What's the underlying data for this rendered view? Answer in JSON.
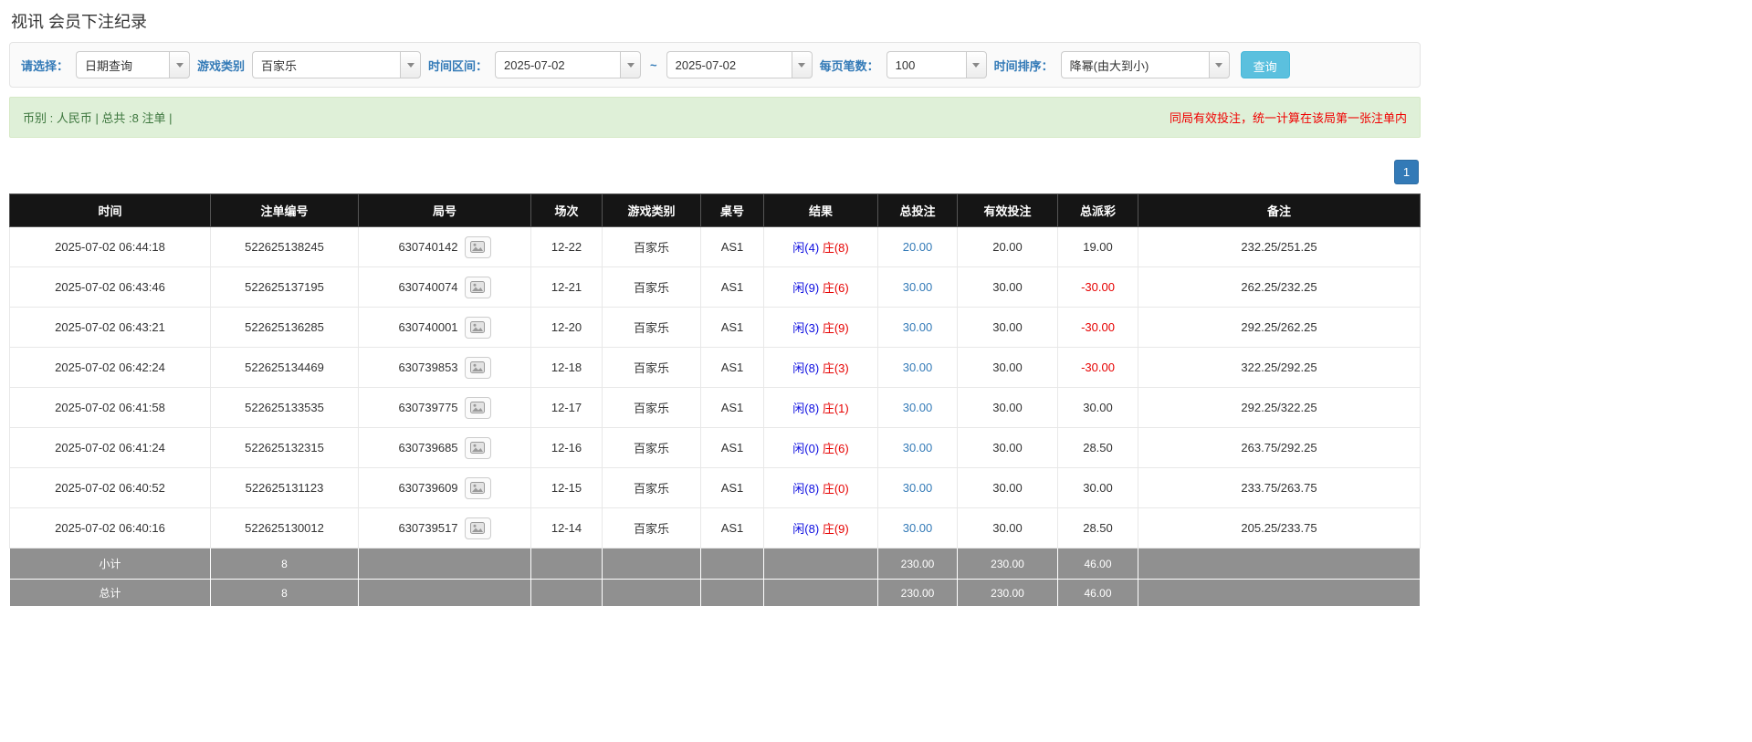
{
  "page": {
    "title": "视讯 会员下注纪录"
  },
  "filters": {
    "select_label": "请选择：",
    "select_value": "日期查询",
    "game_label": "游戏类别",
    "game_value": "百家乐",
    "range_label": "时间区间：",
    "range_from": "2025-07-02",
    "range_sep": "~",
    "range_to": "2025-07-02",
    "page_size_label": "每页笔数：",
    "page_size_value": "100",
    "sort_label": "时间排序：",
    "sort_value": "降幂(由大到小)",
    "search_button": "查询"
  },
  "summary": {
    "left": "币别 : 人民币 | 总共 :8 注单 |",
    "right": "同局有效投注，统一计算在该局第一张注单内"
  },
  "pagination": {
    "page": "1"
  },
  "table": {
    "headers": [
      "时间",
      "注单编号",
      "局号",
      "场次",
      "游戏类别",
      "桌号",
      "结果",
      "总投注",
      "有效投注",
      "总派彩",
      "备注"
    ],
    "rows": [
      {
        "time": "2025-07-02 06:44:18",
        "bet_id": "522625138245",
        "round": "630740142",
        "session": "12-22",
        "game": "百家乐",
        "table_no": "AS1",
        "result_player": "闲(4)",
        "result_banker": "庄(8)",
        "total_bet": "20.00",
        "valid_bet": "20.00",
        "payout": "19.00",
        "remark": "232.25/251.25"
      },
      {
        "time": "2025-07-02 06:43:46",
        "bet_id": "522625137195",
        "round": "630740074",
        "session": "12-21",
        "game": "百家乐",
        "table_no": "AS1",
        "result_player": "闲(9)",
        "result_banker": "庄(6)",
        "total_bet": "30.00",
        "valid_bet": "30.00",
        "payout": "-30.00",
        "remark": "262.25/232.25"
      },
      {
        "time": "2025-07-02 06:43:21",
        "bet_id": "522625136285",
        "round": "630740001",
        "session": "12-20",
        "game": "百家乐",
        "table_no": "AS1",
        "result_player": "闲(3)",
        "result_banker": "庄(9)",
        "total_bet": "30.00",
        "valid_bet": "30.00",
        "payout": "-30.00",
        "remark": "292.25/262.25"
      },
      {
        "time": "2025-07-02 06:42:24",
        "bet_id": "522625134469",
        "round": "630739853",
        "session": "12-18",
        "game": "百家乐",
        "table_no": "AS1",
        "result_player": "闲(8)",
        "result_banker": "庄(3)",
        "total_bet": "30.00",
        "valid_bet": "30.00",
        "payout": "-30.00",
        "remark": "322.25/292.25"
      },
      {
        "time": "2025-07-02 06:41:58",
        "bet_id": "522625133535",
        "round": "630739775",
        "session": "12-17",
        "game": "百家乐",
        "table_no": "AS1",
        "result_player": "闲(8)",
        "result_banker": "庄(1)",
        "total_bet": "30.00",
        "valid_bet": "30.00",
        "payout": "30.00",
        "remark": "292.25/322.25"
      },
      {
        "time": "2025-07-02 06:41:24",
        "bet_id": "522625132315",
        "round": "630739685",
        "session": "12-16",
        "game": "百家乐",
        "table_no": "AS1",
        "result_player": "闲(0)",
        "result_banker": "庄(6)",
        "total_bet": "30.00",
        "valid_bet": "30.00",
        "payout": "28.50",
        "remark": "263.75/292.25"
      },
      {
        "time": "2025-07-02 06:40:52",
        "bet_id": "522625131123",
        "round": "630739609",
        "session": "12-15",
        "game": "百家乐",
        "table_no": "AS1",
        "result_player": "闲(8)",
        "result_banker": "庄(0)",
        "total_bet": "30.00",
        "valid_bet": "30.00",
        "payout": "30.00",
        "remark": "233.75/263.75"
      },
      {
        "time": "2025-07-02 06:40:16",
        "bet_id": "522625130012",
        "round": "630739517",
        "session": "12-14",
        "game": "百家乐",
        "table_no": "AS1",
        "result_player": "闲(8)",
        "result_banker": "庄(9)",
        "total_bet": "30.00",
        "valid_bet": "30.00",
        "payout": "28.50",
        "remark": "205.25/233.75"
      }
    ],
    "footer": [
      {
        "label": "小计",
        "count": "8",
        "total_bet": "230.00",
        "valid_bet": "230.00",
        "payout": "46.00"
      },
      {
        "label": "总计",
        "count": "8",
        "total_bet": "230.00",
        "valid_bet": "230.00",
        "payout": "46.00"
      }
    ]
  }
}
